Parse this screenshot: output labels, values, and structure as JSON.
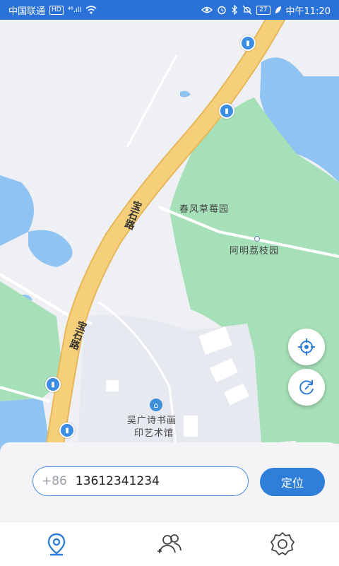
{
  "status_bar": {
    "carrier": "中国联通",
    "hd": "HD",
    "signal": "⁴⁶.ıll",
    "battery": "27",
    "time": "中午11:20"
  },
  "map": {
    "road_name_upper": "宝石路",
    "road_name_lower": "宝石路",
    "poi_strawberry": "春风草莓园",
    "poi_lychee": "阿明荔枝园",
    "poi_museum_line1": "吴广诗书画",
    "poi_museum_line2": "印艺术馆"
  },
  "controls": {
    "locate_me_icon": "crosshair-icon",
    "refresh_icon": "refresh-icon"
  },
  "panel": {
    "country_code": "+86",
    "phone_value": "13612341234",
    "locate_button": "定位"
  },
  "tabbar": {
    "tabs": [
      {
        "icon": "location-pin-icon",
        "active": true
      },
      {
        "icon": "contacts-icon",
        "active": false
      },
      {
        "icon": "settings-icon",
        "active": false
      }
    ]
  },
  "colors": {
    "accent": "#2f7ed8",
    "road": "#f5cf7a",
    "water": "#8fc4f2",
    "park": "#a6e0b8"
  }
}
